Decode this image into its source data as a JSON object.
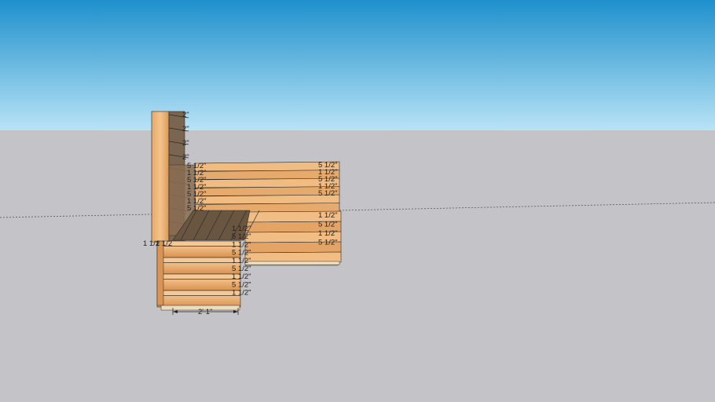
{
  "scene": {
    "sky_top_color": "#1e90cc",
    "sky_bottom_color": "#b9e3f6",
    "ground_color": "#c4c4c8",
    "horizon_line_color": "#555555",
    "wood_light": "#efb97c",
    "wood_dark": "#c98545",
    "wood_shadow": "#6e5a45",
    "edge_color": "#2b2b2b"
  },
  "dimensions": {
    "back_top_labels": [
      "2\"",
      "2\"",
      "2\"",
      "2\""
    ],
    "back_board_labels": [
      "5 1/2\"",
      "1 1/2\"",
      "5 1/2\"",
      "1 1/2\"",
      "5 1/2\"",
      "1 1/2\"",
      "5 1/2\""
    ],
    "right_back_labels": [
      "5 1/2\"",
      "1 1/2\"",
      "5 1/2\"",
      "1 1/2\"",
      "5 1/2\""
    ],
    "right_front_labels": [
      "1 1/2\"",
      "5 1/2\"",
      "1 1/2\"",
      "5 1/2\""
    ],
    "front_labels": [
      "1 1/2\"",
      "5 1/2\"",
      "1 1/2\"",
      "5 1/2\"",
      "1 1/2\"",
      "5 1/2\"",
      "1 1/2\"",
      "5 1/2\"",
      "1 1/2\""
    ],
    "left_label": "1 1/2",
    "left_label_2": "1 1/2",
    "width_label": "2' 1\""
  }
}
